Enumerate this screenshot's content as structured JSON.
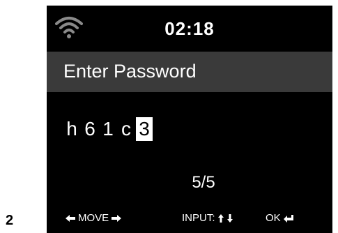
{
  "page_number": "2",
  "status": {
    "time": "02:18",
    "wifi_icon": "wifi-icon"
  },
  "title": "Enter Password",
  "password": {
    "chars": [
      "h",
      "6",
      "1",
      "c"
    ],
    "current_char": "3"
  },
  "counter": "5/5",
  "footer": {
    "move_label": "MOVE",
    "input_label": "INPUT:",
    "ok_label": "OK"
  },
  "colors": {
    "screen": "#000000",
    "title_bar": "#3a3a3a",
    "text": "#ffffff"
  }
}
